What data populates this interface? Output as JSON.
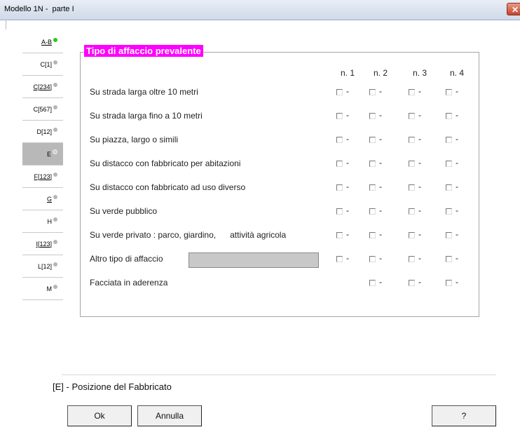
{
  "window": {
    "title": "Modello 1N -  parte I",
    "close_label": "✕"
  },
  "tabs": [
    {
      "label": "A-B",
      "dot": "green",
      "underline": true
    },
    {
      "label": "C[1]",
      "dot": "gray",
      "underline": false
    },
    {
      "label": "C[234]",
      "dot": "gray",
      "underline": true
    },
    {
      "label": "C[567]",
      "dot": "gray",
      "underline": false
    },
    {
      "label": "D[12]",
      "dot": "gray",
      "underline": false
    },
    {
      "label": "E",
      "dot": "hollow",
      "underline": false,
      "active": true
    },
    {
      "label": "F[123]",
      "dot": "gray",
      "underline": true
    },
    {
      "label": "G",
      "dot": "gray",
      "underline": true
    },
    {
      "label": "H",
      "dot": "gray",
      "underline": false
    },
    {
      "label": "I[123]",
      "dot": "gray",
      "underline": true
    },
    {
      "label": "L[12]",
      "dot": "gray",
      "underline": false
    },
    {
      "label": "M",
      "dot": "gray",
      "underline": false
    }
  ],
  "section": {
    "title": "Tipo di affaccio prevalente",
    "columns": [
      "n. 1",
      "n. 2",
      "n. 3",
      "n. 4"
    ],
    "dash": "-",
    "rows": [
      {
        "label": "Su strada larga oltre 10 metri",
        "cols": 4
      },
      {
        "label": "Su strada larga fino a 10 metri",
        "cols": 4
      },
      {
        "label": "Su piazza, largo o simili",
        "cols": 4
      },
      {
        "label": "Su distacco con fabbricato per abitazioni",
        "cols": 4
      },
      {
        "label": "Su distacco con fabbricato ad uso diverso",
        "cols": 4
      },
      {
        "label": "Su verde pubblico",
        "cols": 4
      },
      {
        "label": "Su verde privato : parco, giardino,      attività agricola",
        "cols": 4
      },
      {
        "label": "Altro tipo di affaccio",
        "cols": 4,
        "has_input": true
      },
      {
        "label": "Facciata in aderenza",
        "cols": 3
      }
    ],
    "altro_value": ""
  },
  "footer": {
    "title": "[E] - Posizione del Fabbricato",
    "ok_label": "Ok",
    "cancel_label": "Annulla",
    "help_label": "?"
  },
  "colors": {
    "title_bg": "#ff00ff",
    "active_tab": "#b8b8b8",
    "green_dot": "#22cc22"
  }
}
